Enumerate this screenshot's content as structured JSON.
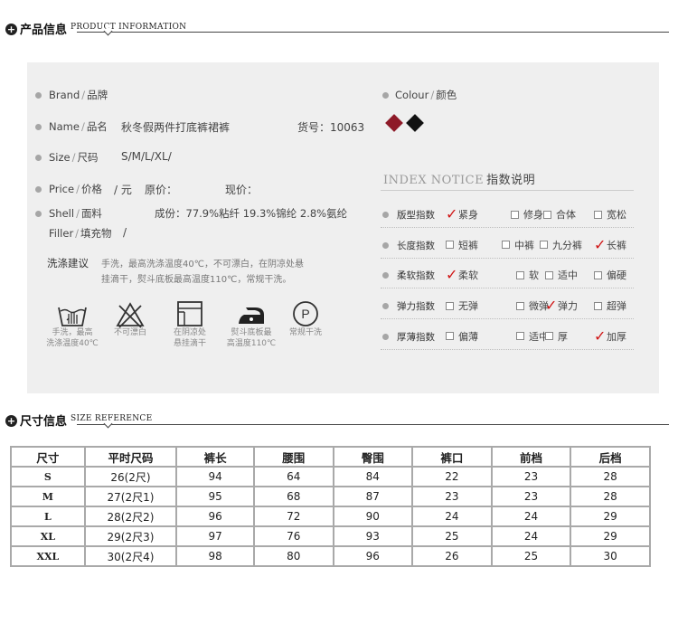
{
  "product_section": {
    "title_cn": "产品信息",
    "title_en": "PRODUCT INFORMATION"
  },
  "size_section": {
    "title_cn": "尺寸信息",
    "title_en": "SIZE REFERENCE"
  },
  "details": {
    "brand_label": "Brand",
    "brand_label_cn": "品牌",
    "name_label": "Name",
    "name_label_cn": "品名",
    "name_value": "秋冬假两件打底裤裙裤",
    "item_no": "货号：10063",
    "size_label": "Size",
    "size_label_cn": "尺码",
    "size_value": "S/M/L/XL/",
    "price_label": "Price",
    "price_label_cn": "价格",
    "price_unit": "/ 元",
    "original_price_label": "原价：",
    "current_price_label": "现价：",
    "shell_label": "Shell",
    "shell_label_cn": "面料",
    "composition": "成份：77.9%粘纤 19.3%锦纶 2.8%氨纶",
    "filler_label": "Filler",
    "filler_label_cn": "填充物",
    "filler_value": "/",
    "colour_label": "Colour",
    "colour_label_cn": "颜色",
    "colors": [
      "#8e1a28",
      "#111111"
    ]
  },
  "wash": {
    "label": "洗涤建议",
    "text_line1": "手洗，最高洗涤温度40℃，不可漂白，在阴凉处悬",
    "text_line2": "挂滴干，熨斗底板最高温度110℃，常规干洗。",
    "icons": [
      {
        "icon": "hand-wash-icon",
        "line1": "手洗，最高",
        "line2": "洗涤温度40℃"
      },
      {
        "icon": "no-bleach-icon",
        "line1": "不可漂白",
        "line2": ""
      },
      {
        "icon": "line-dry-shade-icon",
        "line1": "在阴凉处",
        "line2": "悬挂滴干"
      },
      {
        "icon": "iron-icon",
        "line1": "熨斗底板最",
        "line2": "高温度110℃"
      },
      {
        "icon": "dry-clean-icon",
        "line1": "常规干洗",
        "line2": ""
      }
    ]
  },
  "index_notice": {
    "title_en": "INDEX NOTICE",
    "title_cn": "指数说明",
    "rows": [
      {
        "label": "版型指数",
        "options": [
          "紧身",
          "修身",
          "合体",
          "宽松"
        ],
        "checked": 0
      },
      {
        "label": "长度指数",
        "options": [
          "短裤",
          "中裤",
          "九分裤",
          "长裤"
        ],
        "checked": 3
      },
      {
        "label": "柔软指数",
        "options": [
          "柔软",
          "软",
          "适中",
          "偏硬"
        ],
        "checked": 0
      },
      {
        "label": "弹力指数",
        "options": [
          "无弹",
          "微弹",
          "弹力",
          "超弹"
        ],
        "checked": 2
      },
      {
        "label": "厚薄指数",
        "options": [
          "偏薄",
          "适中",
          "厚",
          "加厚"
        ],
        "checked": 3
      }
    ]
  },
  "size_table": {
    "headers": [
      "尺寸",
      "平时尺码",
      "裤长",
      "腰围",
      "臀围",
      "裤口",
      "前档",
      "后档"
    ],
    "rows": [
      [
        "S",
        "26(2尺)",
        "94",
        "64",
        "84",
        "22",
        "23",
        "28"
      ],
      [
        "M",
        "27(2尺1)",
        "95",
        "68",
        "87",
        "23",
        "23",
        "28"
      ],
      [
        "L",
        "28(2尺2)",
        "96",
        "72",
        "90",
        "24",
        "24",
        "29"
      ],
      [
        "XL",
        "29(2尺3)",
        "97",
        "76",
        "93",
        "25",
        "24",
        "29"
      ],
      [
        "XXL",
        "30(2尺4)",
        "98",
        "80",
        "96",
        "26",
        "25",
        "30"
      ]
    ]
  }
}
